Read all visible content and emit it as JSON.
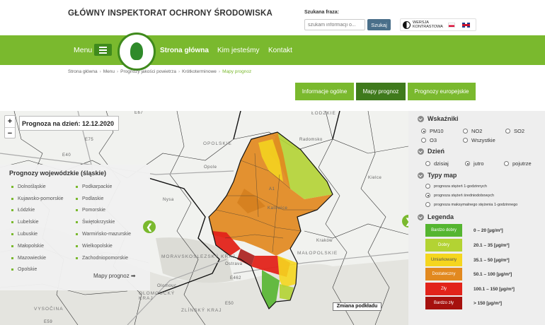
{
  "header": {
    "title": "GŁÓWNY INSPEKTORAT OCHRONY ŚRODOWISKA",
    "search_label": "Szukana fraza:",
    "search_placeholder": "szukam informacji o...",
    "search_button": "Szukaj",
    "contrast_label": "WERSJA KONTRASTOWA"
  },
  "nav": {
    "menu_label": "Menu",
    "links": [
      "Strona główna",
      "Kim jesteśmy",
      "Kontakt"
    ]
  },
  "breadcrumb": [
    "Strona główna",
    "Menu",
    "Prognozy jakości powietrza",
    "Krótkoterminowe",
    "Mapy prognoz"
  ],
  "tabs": [
    {
      "label": "Informacje ogólne",
      "active": false
    },
    {
      "label": "Mapy prognoz",
      "active": true
    },
    {
      "label": "Prognozy europejskie",
      "active": false
    }
  ],
  "map": {
    "zoom_in": "+",
    "zoom_out": "−",
    "forecast_date": "Prognoza na dzień: 12.12.2020",
    "basemap_button": "Zmiana podkładu",
    "arrow_left": "❮",
    "arrow_right": "❯",
    "place_labels": [
      "OPOLSKIE",
      "ŁÓDZKIE",
      "MORAVSKOSLEZSKÝ KRAJ",
      "OLOMOUCKÝ KRAJ",
      "ZLÍNSKÝ KRAJ",
      "VYSOČINA",
      "MAŁOPOLSKIE",
      "Kraków",
      "Katowice",
      "Opole",
      "Ostrava",
      "Radomsko",
      "Kielce",
      "Nysa",
      "Olomouc",
      "E40",
      "E75",
      "E462",
      "E59",
      "E50",
      "A1",
      "E67"
    ]
  },
  "voivodeships": {
    "title": "Prognozy wojewódzkie (śląskie)",
    "col1": [
      "Dolnośląskie",
      "Kujawsko-pomorskie",
      "Łódzkie",
      "Lubelskie",
      "Lubuskie",
      "Małopolskie",
      "Mazowieckie",
      "Opolskie"
    ],
    "col2": [
      "Podkarpackie",
      "Podlaskie",
      "Pomorskie",
      "Świętokrzyskie",
      "Warmińsko-mazurskie",
      "Wielkopolskie",
      "Zachodniopomorskie"
    ],
    "more_link": "Mapy prognoz ➡"
  },
  "panel": {
    "indicators_title": "Wskaźniki",
    "indicators": [
      {
        "label": "PM10",
        "checked": true
      },
      {
        "label": "NO2",
        "checked": false
      },
      {
        "label": "SO2",
        "checked": false
      },
      {
        "label": "O3",
        "checked": false
      },
      {
        "label": "Wszystkie",
        "checked": false
      }
    ],
    "day_title": "Dzień",
    "days": [
      {
        "label": "dzisiaj",
        "checked": false
      },
      {
        "label": "jutro",
        "checked": true
      },
      {
        "label": "pojutrze",
        "checked": false
      }
    ],
    "map_types_title": "Typy map",
    "map_types": [
      {
        "label": "prognoza stężeń 1-godzinnych",
        "checked": false
      },
      {
        "label": "prognoza stężeń średniodobowych",
        "checked": true
      },
      {
        "label": "prognoza maksymalnego stężenia 1-godzinnego",
        "checked": false
      }
    ],
    "legend_title": "Legenda",
    "legend": [
      {
        "label": "Bardzo dobry",
        "range": "0 – 20 [µg/m³]",
        "color": "#55b530",
        "text_color": "#ffffff"
      },
      {
        "label": "Dobry",
        "range": "20.1 – 35 [µg/m³]",
        "color": "#b3d333",
        "text_color": "#ffffff"
      },
      {
        "label": "Umiarkowany",
        "range": "35.1 – 50 [µg/m³]",
        "color": "#f5d61f",
        "text_color": "#555555"
      },
      {
        "label": "Dostateczny",
        "range": "50.1 – 100 [µg/m³]",
        "color": "#e2891f",
        "text_color": "#ffffff"
      },
      {
        "label": "Zły",
        "range": "100.1 – 150 [µg/m³]",
        "color": "#e2231a",
        "text_color": "#ffffff"
      },
      {
        "label": "Bardzo zły",
        "range": "> 150 [µg/m³]",
        "color": "#a6110e",
        "text_color": "#ffffff"
      }
    ]
  }
}
